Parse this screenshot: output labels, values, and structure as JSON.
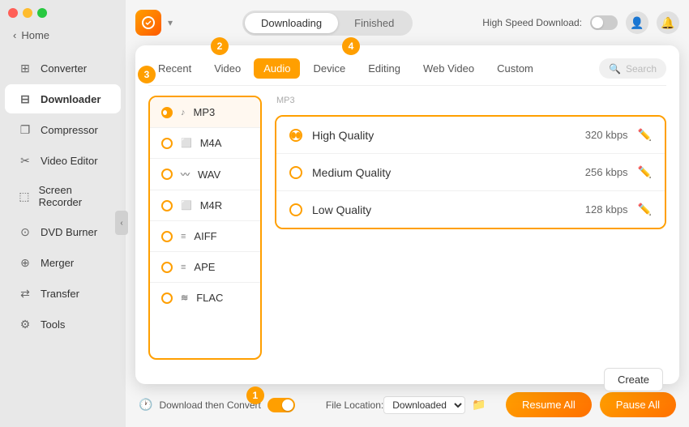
{
  "trafficLights": [
    "close",
    "minimize",
    "maximize"
  ],
  "sidebar": {
    "home": "Home",
    "items": [
      {
        "id": "converter",
        "label": "Converter",
        "icon": "⊞"
      },
      {
        "id": "downloader",
        "label": "Downloader",
        "icon": "⊟"
      },
      {
        "id": "compressor",
        "label": "Compressor",
        "icon": "❐"
      },
      {
        "id": "videoEditor",
        "label": "Video Editor",
        "icon": "✂"
      },
      {
        "id": "screenRecorder",
        "label": "Screen Recorder",
        "icon": "⬚"
      },
      {
        "id": "dvdBurner",
        "label": "DVD Burner",
        "icon": "⊙"
      },
      {
        "id": "merger",
        "label": "Merger",
        "icon": "⊕"
      },
      {
        "id": "transfer",
        "label": "Transfer",
        "icon": "⇄"
      },
      {
        "id": "tools",
        "label": "Tools",
        "icon": "⚙"
      }
    ]
  },
  "topbar": {
    "tabs": [
      "Downloading",
      "Finished"
    ],
    "activeTab": "Downloading",
    "highSpeedLabel": "High Speed Download:",
    "dropdownArrow": "▾"
  },
  "formatTabs": {
    "tabs": [
      "Recent",
      "Video",
      "Audio",
      "Device",
      "Editing",
      "Web Video",
      "Custom"
    ],
    "activeTab": "Audio",
    "searchPlaceholder": "Search"
  },
  "formatList": {
    "items": [
      {
        "id": "mp3",
        "label": "MP3",
        "active": true
      },
      {
        "id": "m4a",
        "label": "M4A",
        "active": false
      },
      {
        "id": "wav",
        "label": "WAV",
        "active": false
      },
      {
        "id": "m4r",
        "label": "M4R",
        "active": false
      },
      {
        "id": "aiff",
        "label": "AIFF",
        "active": false
      },
      {
        "id": "ape",
        "label": "APE",
        "active": false
      },
      {
        "id": "flac",
        "label": "FLAC",
        "active": false
      }
    ],
    "note": "MP3"
  },
  "qualityOptions": {
    "items": [
      {
        "id": "high",
        "label": "High Quality",
        "bitrate": "320 kbps",
        "selected": true
      },
      {
        "id": "medium",
        "label": "Medium Quality",
        "bitrate": "256 kbps",
        "selected": false
      },
      {
        "id": "low",
        "label": "Low Quality",
        "bitrate": "128 kbps",
        "selected": false
      }
    ]
  },
  "stepBadges": [
    {
      "number": "1",
      "label": "Download then Convert toggle"
    },
    {
      "number": "2",
      "label": "Audio tab badge"
    },
    {
      "number": "3",
      "label": "MP3 format badge"
    },
    {
      "number": "4",
      "label": "Web Video tab badge"
    }
  ],
  "bottomBar": {
    "toggleLabel": "Download then Convert",
    "fileLocationLabel": "File Location:",
    "fileLocationValue": "Downloaded",
    "createLabel": "Create",
    "resumeLabel": "Resume All",
    "pauseLabel": "Pause All"
  }
}
